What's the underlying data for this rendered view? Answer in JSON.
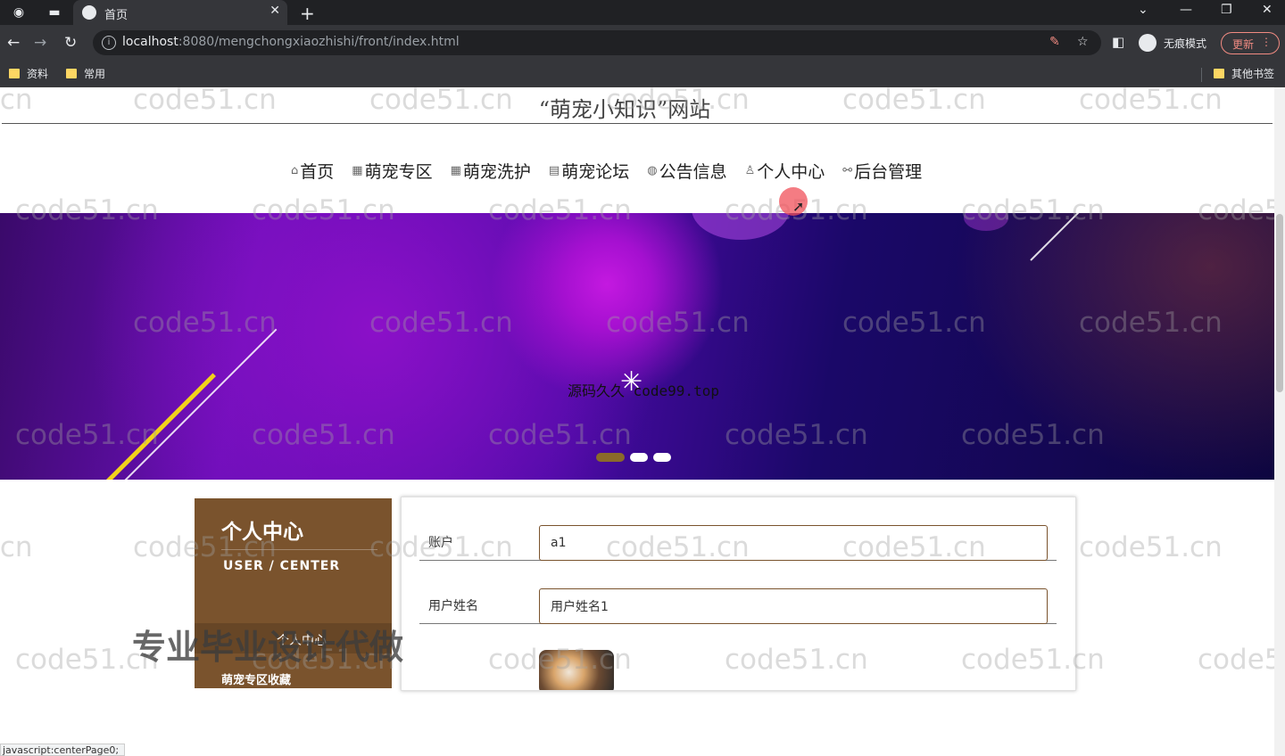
{
  "browser": {
    "tab_title": "首页",
    "url_host": "localhost",
    "url_path": ":8080/mengchongxiaozhishi/front/index.html",
    "incognito_label": "无痕模式",
    "update_label": "更新",
    "bookmarks": [
      "资料",
      "常用"
    ],
    "other_bookmarks": "其他书签",
    "status_text": "javascript:centerPage0;"
  },
  "site": {
    "title": "“萌宠小知识”网站",
    "nav": [
      {
        "icon": "home-icon",
        "glyph": "⌂",
        "label": "首页"
      },
      {
        "icon": "grid-icon",
        "glyph": "▦",
        "label": "萌宠专区"
      },
      {
        "icon": "apps-icon",
        "glyph": "▦",
        "label": "萌宠洗护"
      },
      {
        "icon": "note-icon",
        "glyph": "▤",
        "label": "萌宠论坛"
      },
      {
        "icon": "globe-icon",
        "glyph": "◍",
        "label": "公告信息"
      },
      {
        "icon": "user-icon",
        "glyph": "♙",
        "label": "个人中心"
      },
      {
        "icon": "link-icon",
        "glyph": "⚯",
        "label": "后台管理"
      }
    ]
  },
  "banner": {
    "overlay_text": "源码久久 code99.top",
    "slides": 3,
    "active_slide": 1
  },
  "sidebar": {
    "heading": "个人中心",
    "subheading": "USER / CENTER",
    "items": [
      "个人中心",
      "萌宠专区收藏"
    ]
  },
  "form": {
    "account_label": "账户",
    "account_value": "a1",
    "name_label": "用户姓名",
    "name_value": "用户姓名1"
  },
  "watermarks": {
    "repeat_text": "code51.cn",
    "promo_text": "专业毕业设计代做"
  },
  "colors": {
    "brand_brown": "#7a532d",
    "active_dot": "#8a6a2a"
  }
}
